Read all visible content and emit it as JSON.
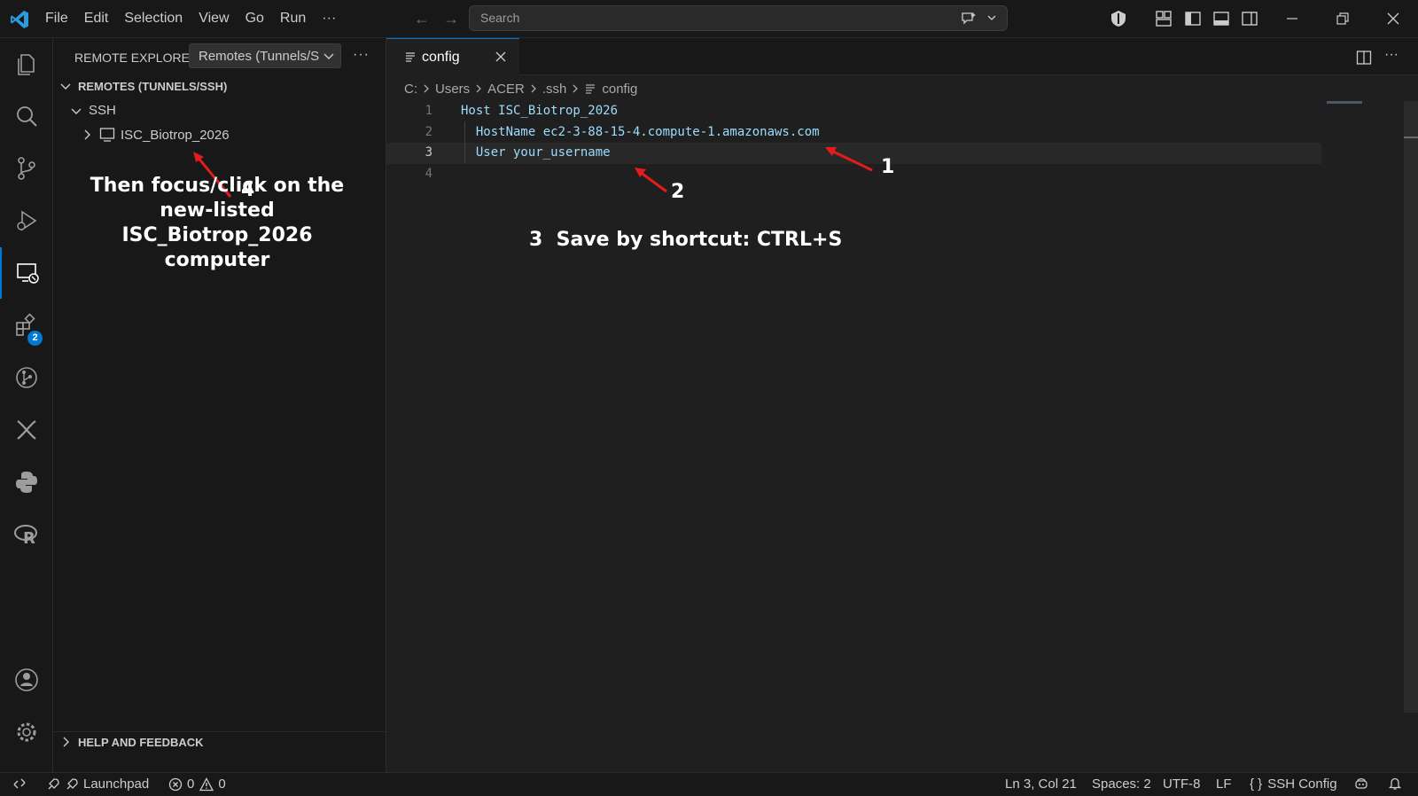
{
  "menu": [
    "File",
    "Edit",
    "Selection",
    "View",
    "Go",
    "Run",
    "···"
  ],
  "search": {
    "placeholder": "Search"
  },
  "sidebar": {
    "title": "REMOTE EXPLORER",
    "selector_value": "Remotes (Tunnels/SSH)",
    "more": "···",
    "section_remotes": "REMOTES (TUNNELS/SSH)",
    "ssh_group": "SSH",
    "host": "ISC_Biotrop_2026",
    "section_help": "HELP AND FEEDBACK",
    "extensions_badge": "2"
  },
  "tab": {
    "label": "config"
  },
  "breadcrumb": [
    "C:",
    "Users",
    "ACER",
    ".ssh",
    "config"
  ],
  "code": {
    "lines": [
      {
        "n": "1",
        "text": "Host ISC_Biotrop_2026"
      },
      {
        "n": "2",
        "text": "  HostName ec2-3-88-15-4.compute-1.amazonaws.com"
      },
      {
        "n": "3",
        "text": "  User your_username"
      },
      {
        "n": "4",
        "text": ""
      }
    ],
    "current_line": 3
  },
  "annotations": {
    "a1": "1",
    "a2": "2",
    "a3": "3  Save by shortcut: CTRL+S",
    "a4_num": "4",
    "a4_text": "Then focus/click on the new-listed ISC_Biotrop_2026 computer",
    "arrow_color": "#e31b1b"
  },
  "status": {
    "launchpad": "Launchpad",
    "errors": "0",
    "warnings": "0",
    "position": "Ln 3, Col 21",
    "spaces": "Spaces: 2",
    "encoding": "UTF-8",
    "eol": "LF",
    "language": "SSH Config"
  },
  "colors": {
    "accent": "#0078d4",
    "keyword": "#9cdcfe",
    "bg": "#1f1f1f"
  }
}
